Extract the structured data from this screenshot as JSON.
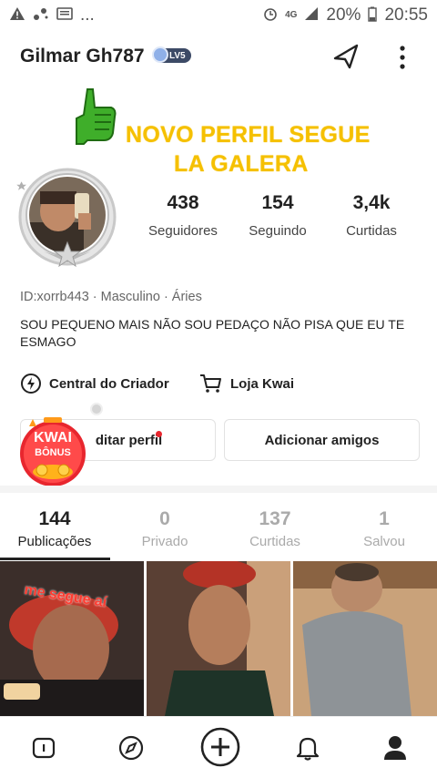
{
  "status_bar": {
    "notification_icons": [
      "warning-icon",
      "signal-dots-icon",
      "message-icon"
    ],
    "ellipsis": "...",
    "network": "4G",
    "battery": "20%",
    "time": "20:55"
  },
  "profile": {
    "username": "Gilmar Gh787",
    "level_badge": "LV5",
    "banner_line_1": "NOVO PERFIL SEGUE",
    "banner_line_2": "LA GALERA",
    "stats": [
      {
        "value": "438",
        "label": "Seguidores"
      },
      {
        "value": "154",
        "label": "Seguindo"
      },
      {
        "value": "3,4k",
        "label": "Curtidas"
      }
    ],
    "meta": "ID:xorrb443 · Masculino · Áries",
    "bio": "SOU PEQUENO MAIS NÃO SOU PEDAÇO NÃO PISA QUE EU TE ESMAGO"
  },
  "links": {
    "creator_center": "Central do Criador",
    "store": "Loja Kwai"
  },
  "buttons": {
    "edit_profile": "ditar perfil",
    "add_friends": "Adicionar amigos"
  },
  "kwai_bonus": {
    "line1": "KWAI",
    "line2": "BÔNUS"
  },
  "tabs": [
    {
      "count": "144",
      "label": "Publicações",
      "active": true
    },
    {
      "count": "0",
      "label": "Privado",
      "active": false
    },
    {
      "count": "137",
      "label": "Curtidas",
      "active": false
    },
    {
      "count": "1",
      "label": "Salvou",
      "active": false
    }
  ],
  "grid": {
    "video_1_caption": "me segue aí"
  },
  "colors": {
    "banner_yellow": "#f5c000",
    "notification_red": "#e8262e",
    "bonus_orange": "#ff7a1a"
  }
}
